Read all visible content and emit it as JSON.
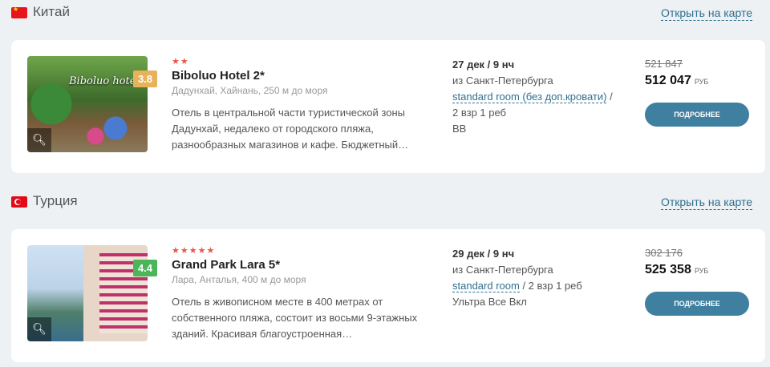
{
  "sections": [
    {
      "country": "Китай",
      "map_link": "Открыть на карте",
      "hotel": {
        "rating": "3.8",
        "stars": "★★",
        "name": "Biboluo Hotel 2*",
        "location": "Дадунхай, Хайнань, 250 м до моря",
        "description": "Отель в центральной части туристической зоны Дадунхай, недалеко от городского пляжа, разнообразных магазинов и кафе. Бюджетный…",
        "image_caption": "Biboluo hotel",
        "dates": "27 дек / 9 нч",
        "departure": "из Санкт-Петербурга",
        "room": "standard room (без доп.кровати)",
        "guests": " / 2 взр 1 реб",
        "meal": "BB",
        "old_price": "521 847",
        "price": "512 047",
        "currency": "РУБ",
        "button": "ПОДРОБНЕЕ"
      }
    },
    {
      "country": "Турция",
      "map_link": "Открыть на карте",
      "hotel": {
        "rating": "4.4",
        "stars": "★★★★★",
        "name": "Grand Park Lara 5*",
        "location": "Лара, Анталья, 400 м до моря",
        "description": "Отель в живописном месте в 400 метрах от собственного пляжа, состоит из восьми 9-этажных зданий. Красивая благоустроенная…",
        "dates": "29 дек / 9 нч",
        "departure": "из Санкт-Петербурга",
        "room": "standard room",
        "guests": " / 2 взр 1 реб",
        "meal": "Ультра Все Вкл",
        "old_price": "302 176",
        "price": "525 358",
        "currency": "РУБ",
        "button": "ПОДРОБНЕЕ"
      }
    }
  ],
  "icons": {
    "search": "magnifier-icon"
  }
}
